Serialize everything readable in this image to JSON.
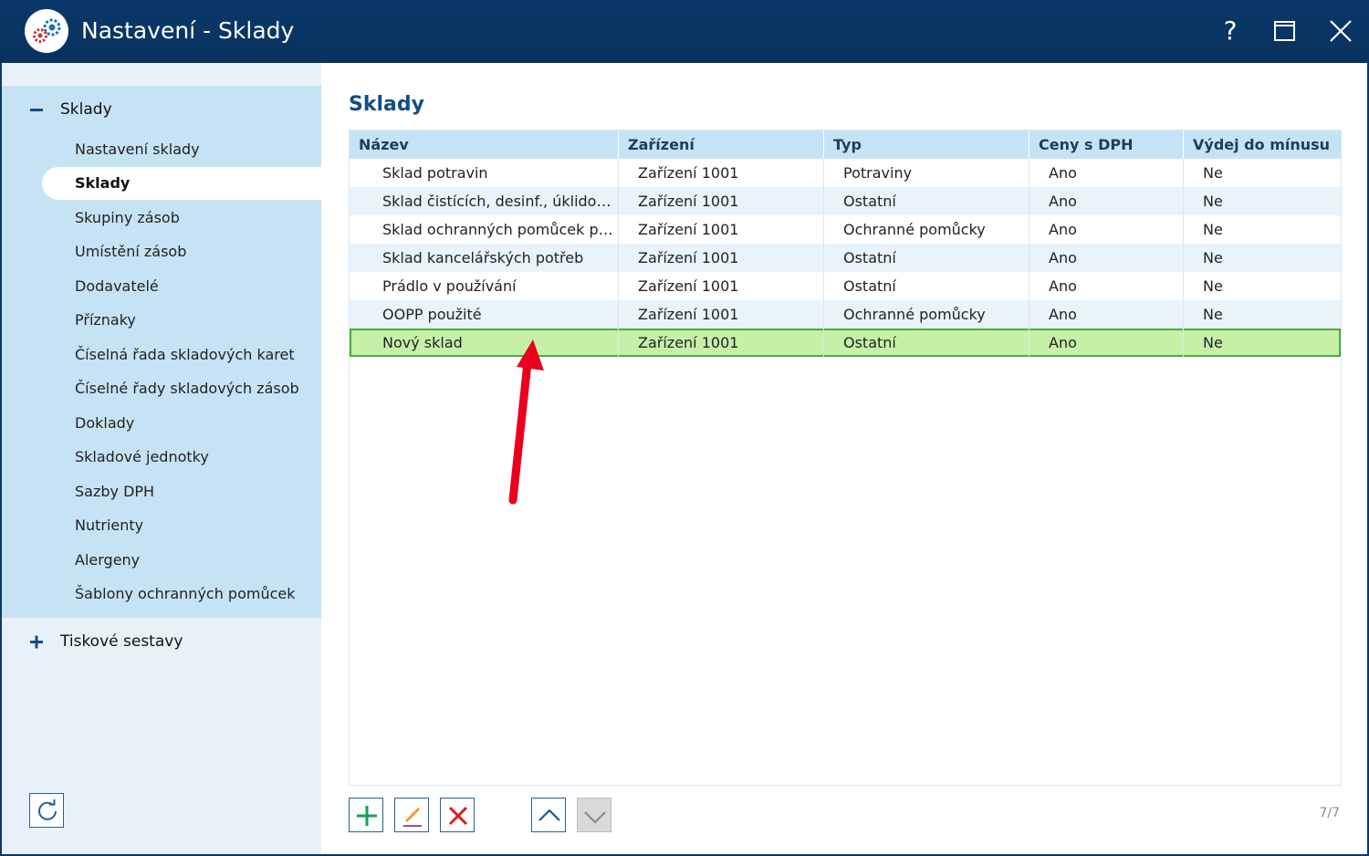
{
  "window": {
    "title": "Nastavení - Sklady",
    "help_label": "?"
  },
  "sidebar": {
    "groups": [
      {
        "label": "Sklady",
        "expanded": true,
        "items": [
          {
            "label": "Nastavení sklady",
            "active": false
          },
          {
            "label": "Sklady",
            "active": true
          },
          {
            "label": "Skupiny zásob",
            "active": false
          },
          {
            "label": "Umístění zásob",
            "active": false
          },
          {
            "label": "Dodavatelé",
            "active": false
          },
          {
            "label": "Příznaky",
            "active": false
          },
          {
            "label": "Číselná řada skladových karet",
            "active": false
          },
          {
            "label": "Číselné řady skladových zásob",
            "active": false
          },
          {
            "label": "Doklady",
            "active": false
          },
          {
            "label": "Skladové jednotky",
            "active": false
          },
          {
            "label": "Sazby DPH",
            "active": false
          },
          {
            "label": "Nutrienty",
            "active": false
          },
          {
            "label": "Alergeny",
            "active": false
          },
          {
            "label": "Šablony ochranných pomůcek",
            "active": false
          }
        ]
      },
      {
        "label": "Tiskové sestavy",
        "expanded": false,
        "items": []
      }
    ]
  },
  "main": {
    "title": "Sklady",
    "table": {
      "columns": [
        "Název",
        "Zařízení",
        "Typ",
        "Ceny s DPH",
        "Výdej do mínusu"
      ],
      "rows": [
        [
          "Sklad potravin",
          "Zařízení 1001",
          "Potraviny",
          "Ano",
          "Ne"
        ],
        [
          "Sklad čistících, desinf., úklidovýc...",
          "Zařízení 1001",
          "Ostatní",
          "Ano",
          "Ne"
        ],
        [
          "Sklad ochranných pomůcek pro ...",
          "Zařízení 1001",
          "Ochranné pomůcky",
          "Ano",
          "Ne"
        ],
        [
          "Sklad kancelářských potřeb",
          "Zařízení 1001",
          "Ostatní",
          "Ano",
          "Ne"
        ],
        [
          "Prádlo v používání",
          "Zařízení 1001",
          "Ostatní",
          "Ano",
          "Ne"
        ],
        [
          "OOPP použité",
          "Zařízení 1001",
          "Ochranné pomůcky",
          "Ano",
          "Ne"
        ],
        [
          "Nový sklad",
          "Zařízení 1001",
          "Ostatní",
          "Ano",
          "Ne"
        ]
      ],
      "selected_row_index": 6
    },
    "row_count": "7/7"
  },
  "colors": {
    "titlebar": "#0b3869",
    "accent_title": "#124e86",
    "selected_row": "#c6f0a8",
    "annotation_arrow": "#e8001c"
  }
}
